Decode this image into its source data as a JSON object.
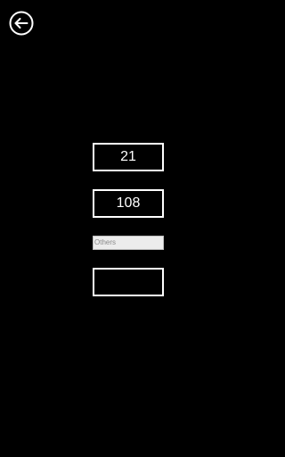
{
  "header": {
    "back_icon": "arrow-left-circle-icon"
  },
  "fields": {
    "value_1": "21",
    "value_2": "108",
    "category": "Others",
    "value_4": ""
  },
  "colors": {
    "background": "#000000",
    "foreground": "#ffffff",
    "select_background": "#ececec",
    "select_text": "#8a8a8a"
  }
}
